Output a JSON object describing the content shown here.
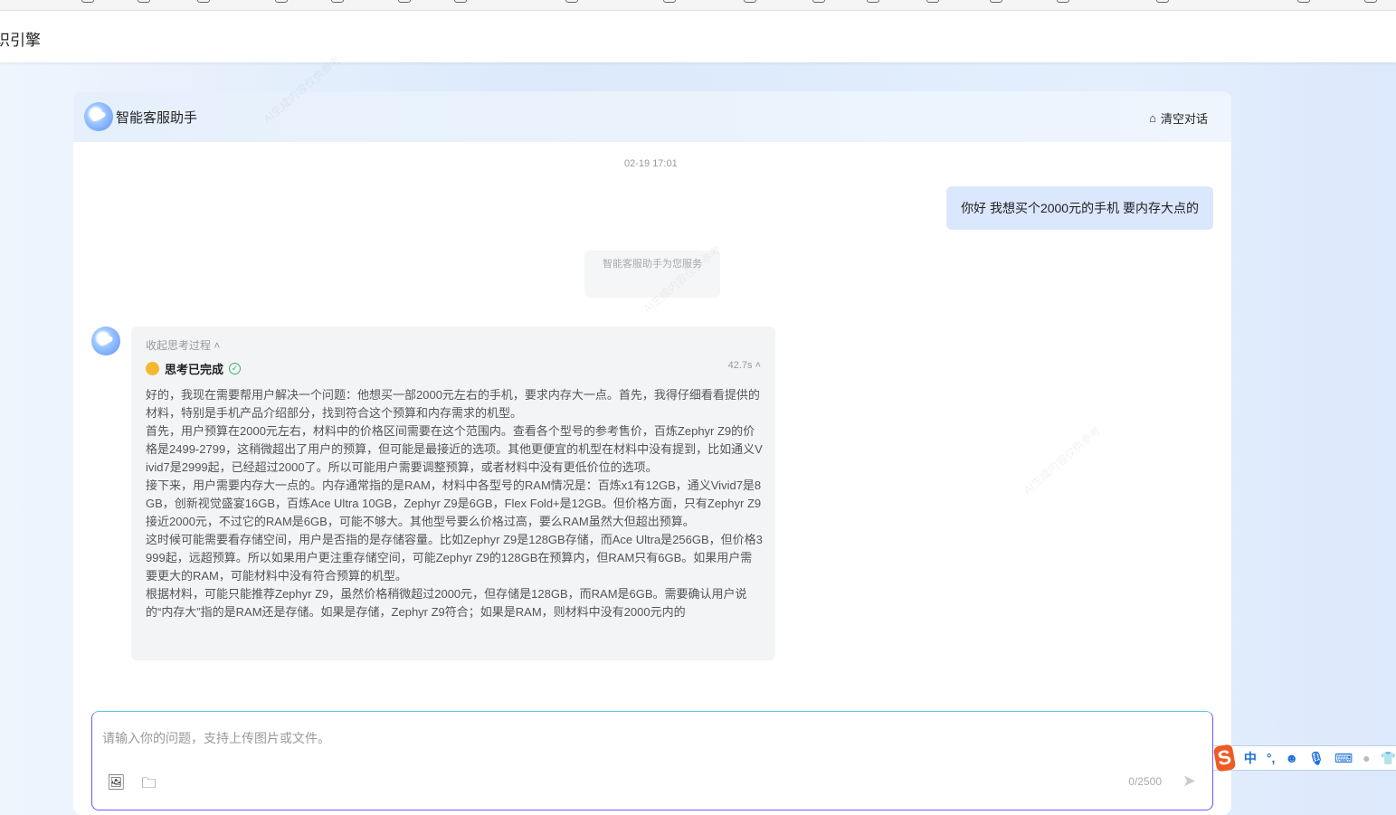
{
  "app": {
    "title_fragment": "识引擎"
  },
  "chat": {
    "title": "智能客服助手",
    "clear_label": "清空对话",
    "timestamp": "02-19 17:01",
    "user_message": "你好 我想买个2000元的手机 要内存大点的",
    "system_notice": "智能客服助手为您服务",
    "thinking": {
      "collapse_label": "收起思考过程",
      "status": "思考已完成",
      "duration": "42.7s",
      "paragraphs": [
        "好的，我现在需要帮用户解决一个问题：他想买一部2000元左右的手机，要求内存大一点。首先，我得仔细看看提供的材料，特别是手机产品介绍部分，找到符合这个预算和内存需求的机型。",
        "首先，用户预算在2000元左右，材料中的价格区间需要在这个范围内。查看各个型号的参考售价，百炼Zephyr Z9的价格是2499-2799，这稍微超出了用户的预算，但可能是最接近的选项。其他更便宜的机型在材料中没有提到，比如通义Vivid7是2999起，已经超过2000了。所以可能用户需要调整预算，或者材料中没有更低价位的选项。",
        "接下来，用户需要内存大一点的。内存通常指的是RAM，材料中各型号的RAM情况是：百炼x1有12GB，通义Vivid7是8GB，创新视觉盛宴16GB，百炼Ace Ultra 10GB，Zephyr Z9是6GB，Flex Fold+是12GB。但价格方面，只有Zephyr Z9接近2000元，不过它的RAM是6GB，可能不够大。其他型号要么价格过高，要么RAM虽然大但超出预算。",
        "这时候可能需要看存储空间，用户是否指的是存储容量。比如Zephyr Z9是128GB存储，而Ace Ultra是256GB，但价格3999起，远超预算。所以如果用户更注重存储空间，可能Zephyr Z9的128GB在预算内，但RAM只有6GB。如果用户需要更大的RAM，可能材料中没有符合预算的机型。",
        "根据材料，可能只能推荐Zephyr Z9，虽然价格稍微超过2000元，但存储是128GB，而RAM是6GB。需要确认用户说的“内存大”指的是RAM还是存储。如果是存储，Zephyr Z9符合；如果是RAM，则材料中没有2000元内的"
      ]
    },
    "input": {
      "placeholder": "请输入你的问题，支持上传图片或文件。",
      "counter": "0/2500"
    }
  },
  "ime": {
    "lang": "中",
    "punct": "°,"
  }
}
